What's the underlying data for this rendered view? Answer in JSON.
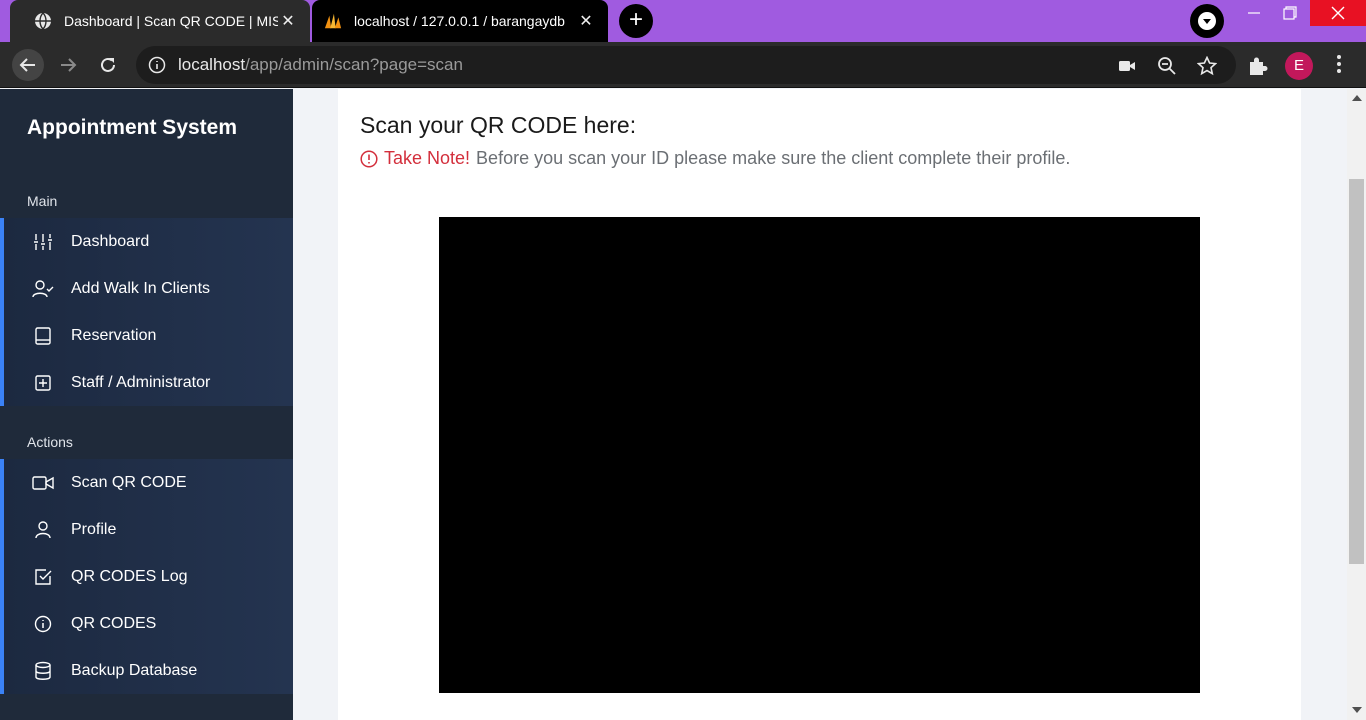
{
  "browser": {
    "tabs": [
      {
        "title": "Dashboard | Scan QR CODE | MIS",
        "active": true
      },
      {
        "title": "localhost / 127.0.0.1 / barangaydb",
        "active": false
      }
    ],
    "url_host": "localhost",
    "url_path": "/app/admin/scan?page=scan",
    "profile_initial": "E",
    "new_tab_label": "+",
    "close_glyph": "✕"
  },
  "sidebar": {
    "brand": "Appointment System",
    "sections": [
      {
        "label": "Main",
        "items": [
          {
            "label": "Dashboard",
            "icon": "sliders-icon"
          },
          {
            "label": "Add Walk In Clients",
            "icon": "user-check-icon"
          },
          {
            "label": "Reservation",
            "icon": "book-icon"
          },
          {
            "label": "Staff / Administrator",
            "icon": "plus-square-icon"
          }
        ]
      },
      {
        "label": "Actions",
        "items": [
          {
            "label": "Scan QR CODE",
            "icon": "video-icon"
          },
          {
            "label": "Profile",
            "icon": "user-icon"
          },
          {
            "label": "QR CODES Log",
            "icon": "check-square-icon"
          },
          {
            "label": "QR CODES",
            "icon": "info-icon"
          },
          {
            "label": "Backup Database",
            "icon": "database-icon"
          }
        ]
      }
    ]
  },
  "main": {
    "heading": "Scan your QR CODE here:",
    "note_label": "Take Note!",
    "note_text": "Before you scan your ID please make sure the client complete their profile."
  },
  "colors": {
    "tabbar": "#a05be0",
    "sidebar": "#1f2a3a",
    "accent": "#3b82f6",
    "warning": "#d32f3c"
  }
}
